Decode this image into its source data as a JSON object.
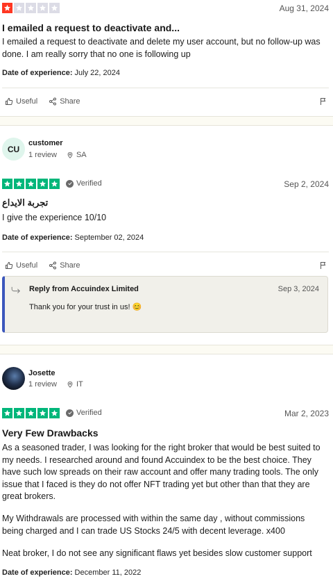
{
  "reviews": [
    {
      "rating": 1,
      "date": "Aug 31, 2024",
      "title": "I emailed a request to deactivate and...",
      "body": "I emailed a request to deactivate and delete my user account, but no follow-up was done. I am really sorry that no one is following up",
      "doe_label": "Date of experience:",
      "doe_value": "July 22, 2024",
      "useful_label": "Useful",
      "share_label": "Share"
    },
    {
      "user_initials": "CU",
      "user_name": "customer",
      "review_count": "1 review",
      "country": "SA",
      "rating": 5,
      "verified_label": "Verified",
      "date": "Sep 2, 2024",
      "title": "تجربة الايداع",
      "body": "I give the experience 10/10",
      "doe_label": "Date of experience:",
      "doe_value": "September 02, 2024",
      "useful_label": "Useful",
      "share_label": "Share",
      "reply": {
        "from": "Reply from Accuindex Limited",
        "date": "Sep 3, 2024",
        "text": "Thank you for your trust in us! 😊"
      }
    },
    {
      "user_name": "Josette",
      "review_count": "1 review",
      "country": "IT",
      "rating": 5,
      "verified_label": "Verified",
      "date": "Mar 2, 2023",
      "title": "Very Few Drawbacks",
      "body_p1": "As a seasoned trader, I was looking for the right broker that would be best suited to my needs. I researched around and found Accuindex to be the best choice. They have such low spreads on their raw account and offer many trading tools. The only issue that I faced is they do not offer NFT trading yet but other than that they are great brokers.",
      "body_p2": "My Withdrawals are processed with within the same day , without commissions being charged and I can trade US Stocks 24/5 with decent leverage. x400",
      "body_p3": "Neat broker, I do not see any significant flaws yet besides slow customer support",
      "doe_label": "Date of experience:",
      "doe_value": "December 11, 2022"
    }
  ],
  "colors": {
    "star_red": "#ff3722",
    "star_green": "#00b67a",
    "star_empty": "#dcdce6",
    "reply_accent": "#3c57bc"
  }
}
